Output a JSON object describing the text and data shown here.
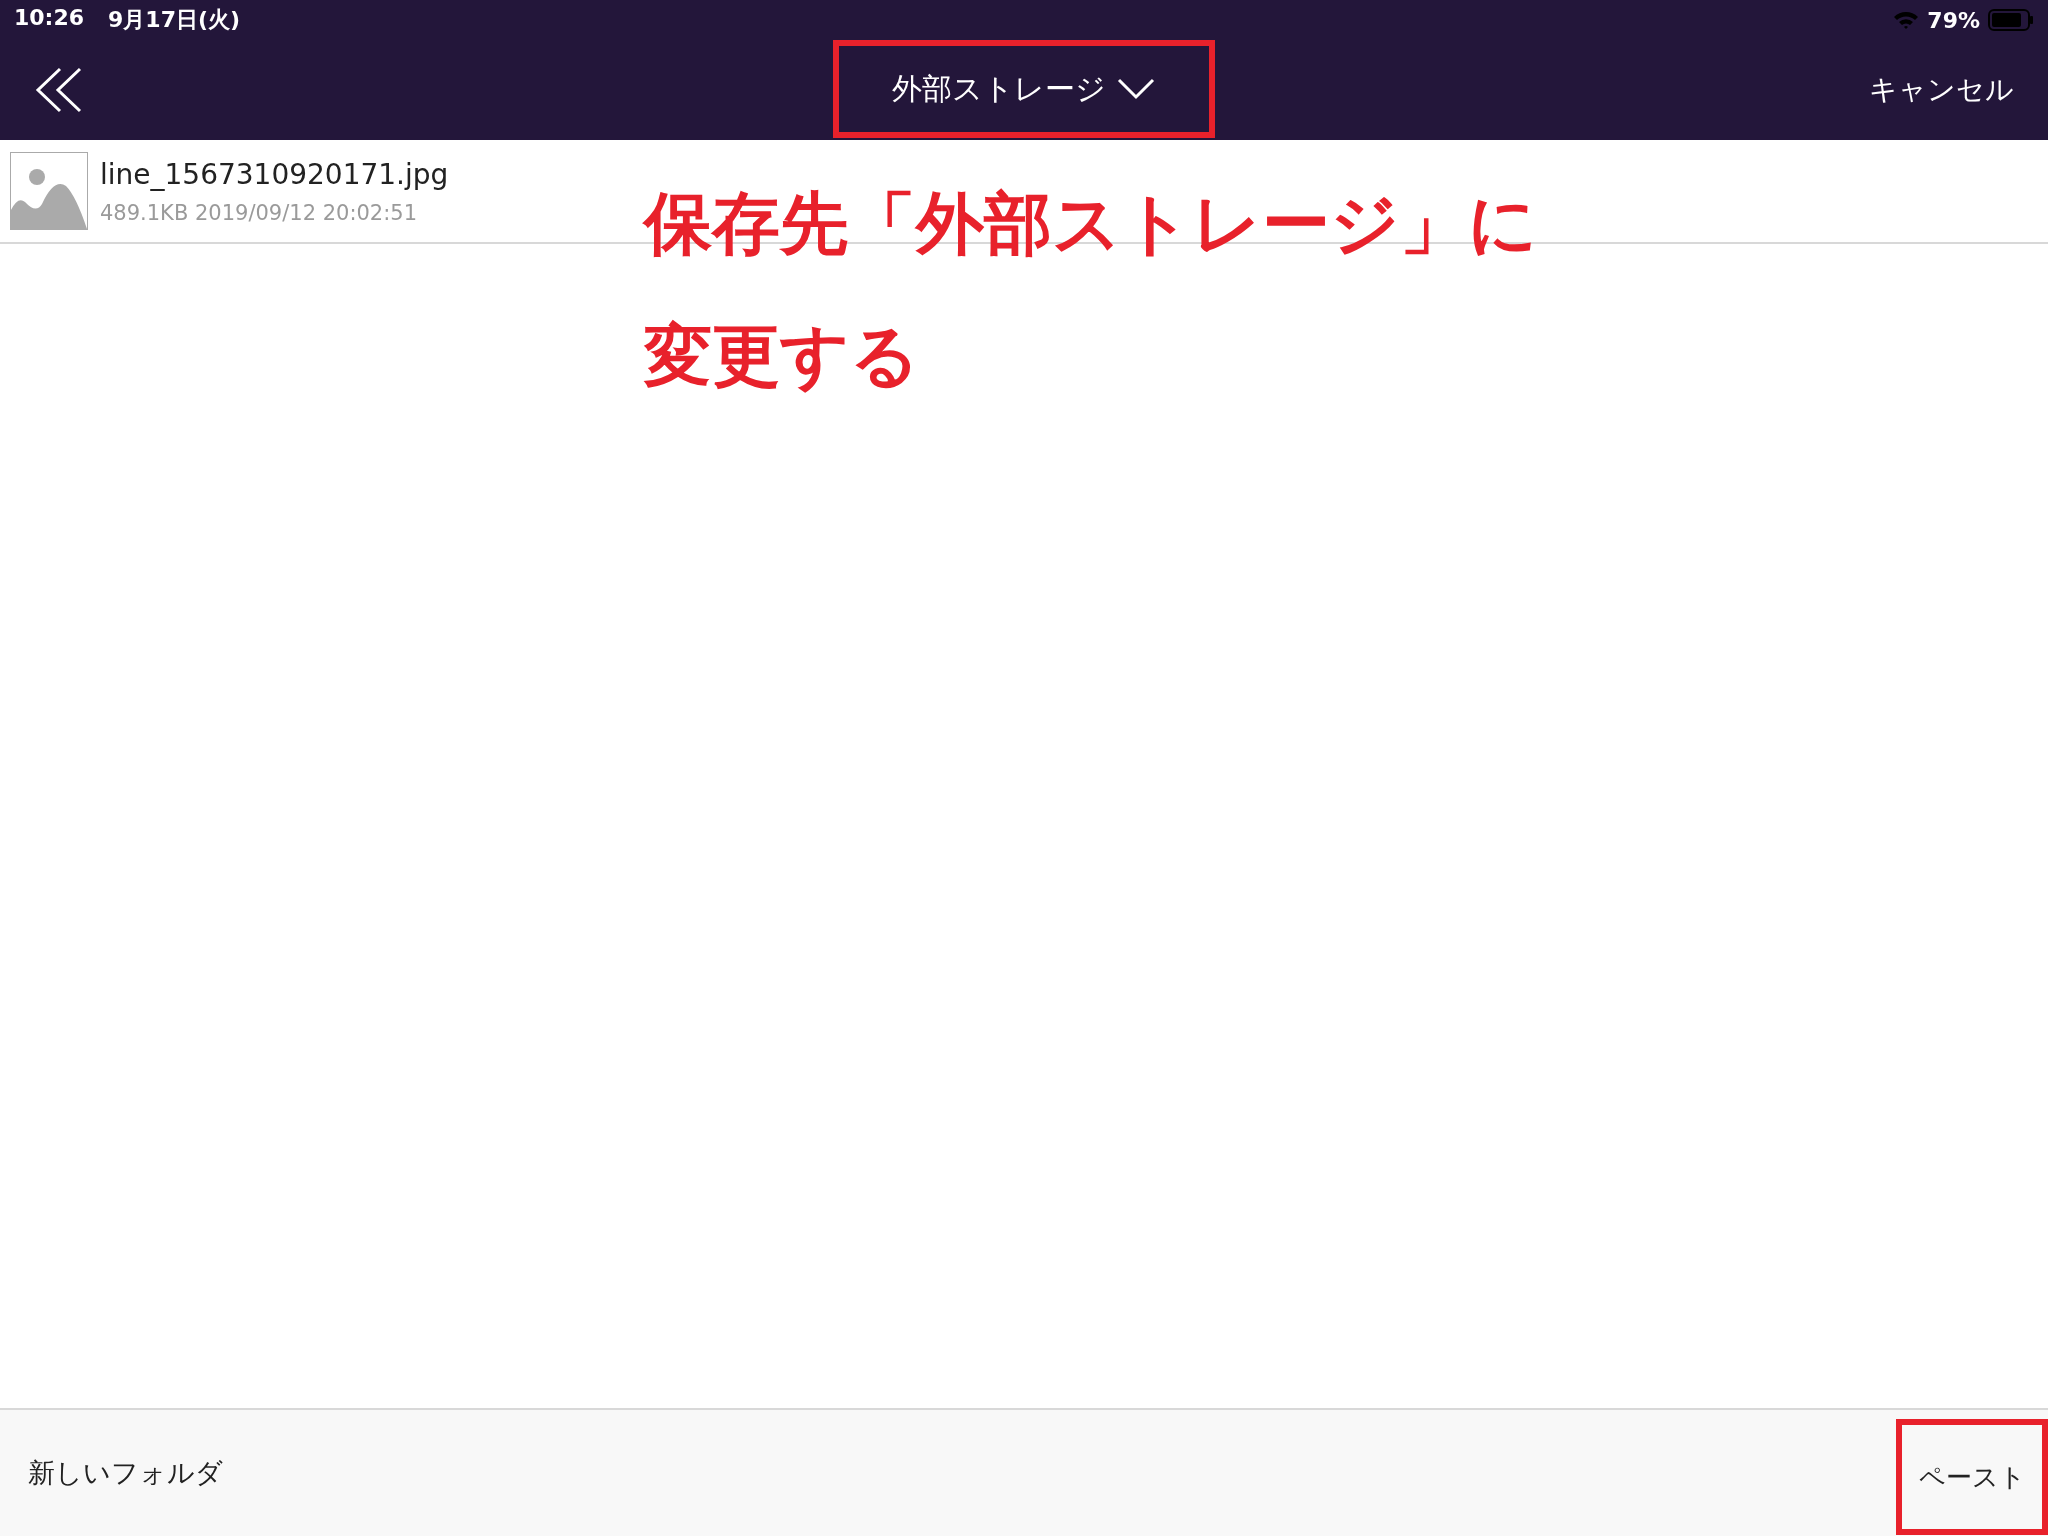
{
  "status_bar": {
    "time": "10:26",
    "date": "9月17日(火)",
    "battery": "79%"
  },
  "nav_bar": {
    "storage_selector": {
      "label": "外部ストレージ",
      "highlighted": true
    },
    "cancel": "キャンセル"
  },
  "files": [
    {
      "name": "line_1567310920171.jpg",
      "meta": "489.1KB 2019/09/12 20:02:51"
    }
  ],
  "toolbar": {
    "new_folder": {
      "label": "新しいフォルダ",
      "highlighted": false
    },
    "paste": {
      "label": "ペースト",
      "highlighted": true
    }
  },
  "annotation": {
    "lines": [
      "保存先「外部ストレージ」に",
      "変更する"
    ]
  }
}
